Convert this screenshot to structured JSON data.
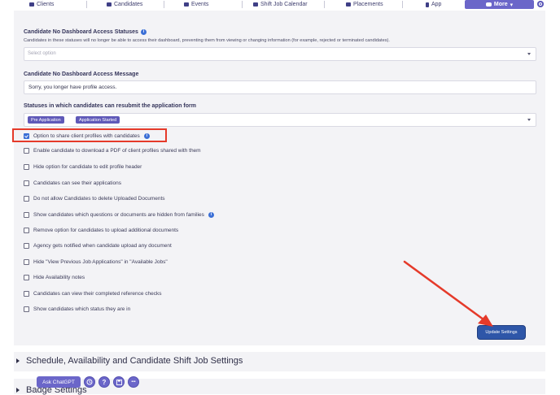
{
  "nav": {
    "items": [
      {
        "label": "Clients",
        "icon": "clients-icon"
      },
      {
        "label": "Candidates",
        "icon": "candidates-icon"
      },
      {
        "label": "Events",
        "icon": "events-icon"
      },
      {
        "label": "Shift Job Calendar",
        "icon": "calendar-icon"
      },
      {
        "label": "Placements",
        "icon": "placements-icon"
      },
      {
        "label": "App",
        "icon": "phone-icon"
      }
    ],
    "more_label": "More",
    "more_caret": "▾",
    "accent": "#6b66c9"
  },
  "settings": {
    "no_access_statuses": {
      "label": "Candidate No Dashboard Access Statuses",
      "help": "Candidates in these statuses will no longer be able to access their dashboard, preventing them from viewing or changing information (for example, rejected or terminated candidates).",
      "placeholder": "Select option"
    },
    "no_access_message": {
      "label": "Candidate No Dashboard Access Message",
      "value": "Sorry, you longer have profile access."
    },
    "resubmit_statuses": {
      "label": "Statuses in which candidates can resubmit the application form",
      "tags": [
        "Pre Application",
        "Application Started"
      ]
    },
    "options": [
      {
        "label": "Option to share client profiles with candidates",
        "checked": true,
        "info": true
      },
      {
        "label": "Enable candidate to download a PDF of client profiles shared with them",
        "checked": false,
        "info": false
      },
      {
        "label": "Hide option for candidate to edit profile header",
        "checked": false,
        "info": false
      },
      {
        "label": "Candidates can see their applications",
        "checked": false,
        "info": false
      },
      {
        "label": "Do not allow Candidates to delete Uploaded Documents",
        "checked": false,
        "info": false
      },
      {
        "label": "Show candidates which questions or documents are hidden from families",
        "checked": false,
        "info": true
      },
      {
        "label": "Remove option for candidates to upload additional documents",
        "checked": false,
        "info": false
      },
      {
        "label": "Agency gets notified when candidate upload any document",
        "checked": false,
        "info": false
      },
      {
        "label": "Hide \"View Previous Job Applications\" in \"Available Jobs\"",
        "checked": false,
        "info": false
      },
      {
        "label": "Hide Availability notes",
        "checked": false,
        "info": false
      },
      {
        "label": "Candidates can view their completed reference checks",
        "checked": false,
        "info": false
      },
      {
        "label": "Show candidates which status they are in",
        "checked": false,
        "info": false
      }
    ],
    "update_button": "Update Settings",
    "info_glyph": "i"
  },
  "sections": [
    {
      "title": "Schedule, Availability and Candidate Shift Job Settings"
    },
    {
      "title": "Badge Settings"
    }
  ],
  "floating": {
    "chat_label": "Ask ChatGPT",
    "help_glyph": "?",
    "more_glyph": "•••"
  },
  "colors": {
    "annotation_red": "#e53a2a",
    "button_blue": "#2e56a8",
    "checkbox_blue": "#3b6fd6"
  }
}
